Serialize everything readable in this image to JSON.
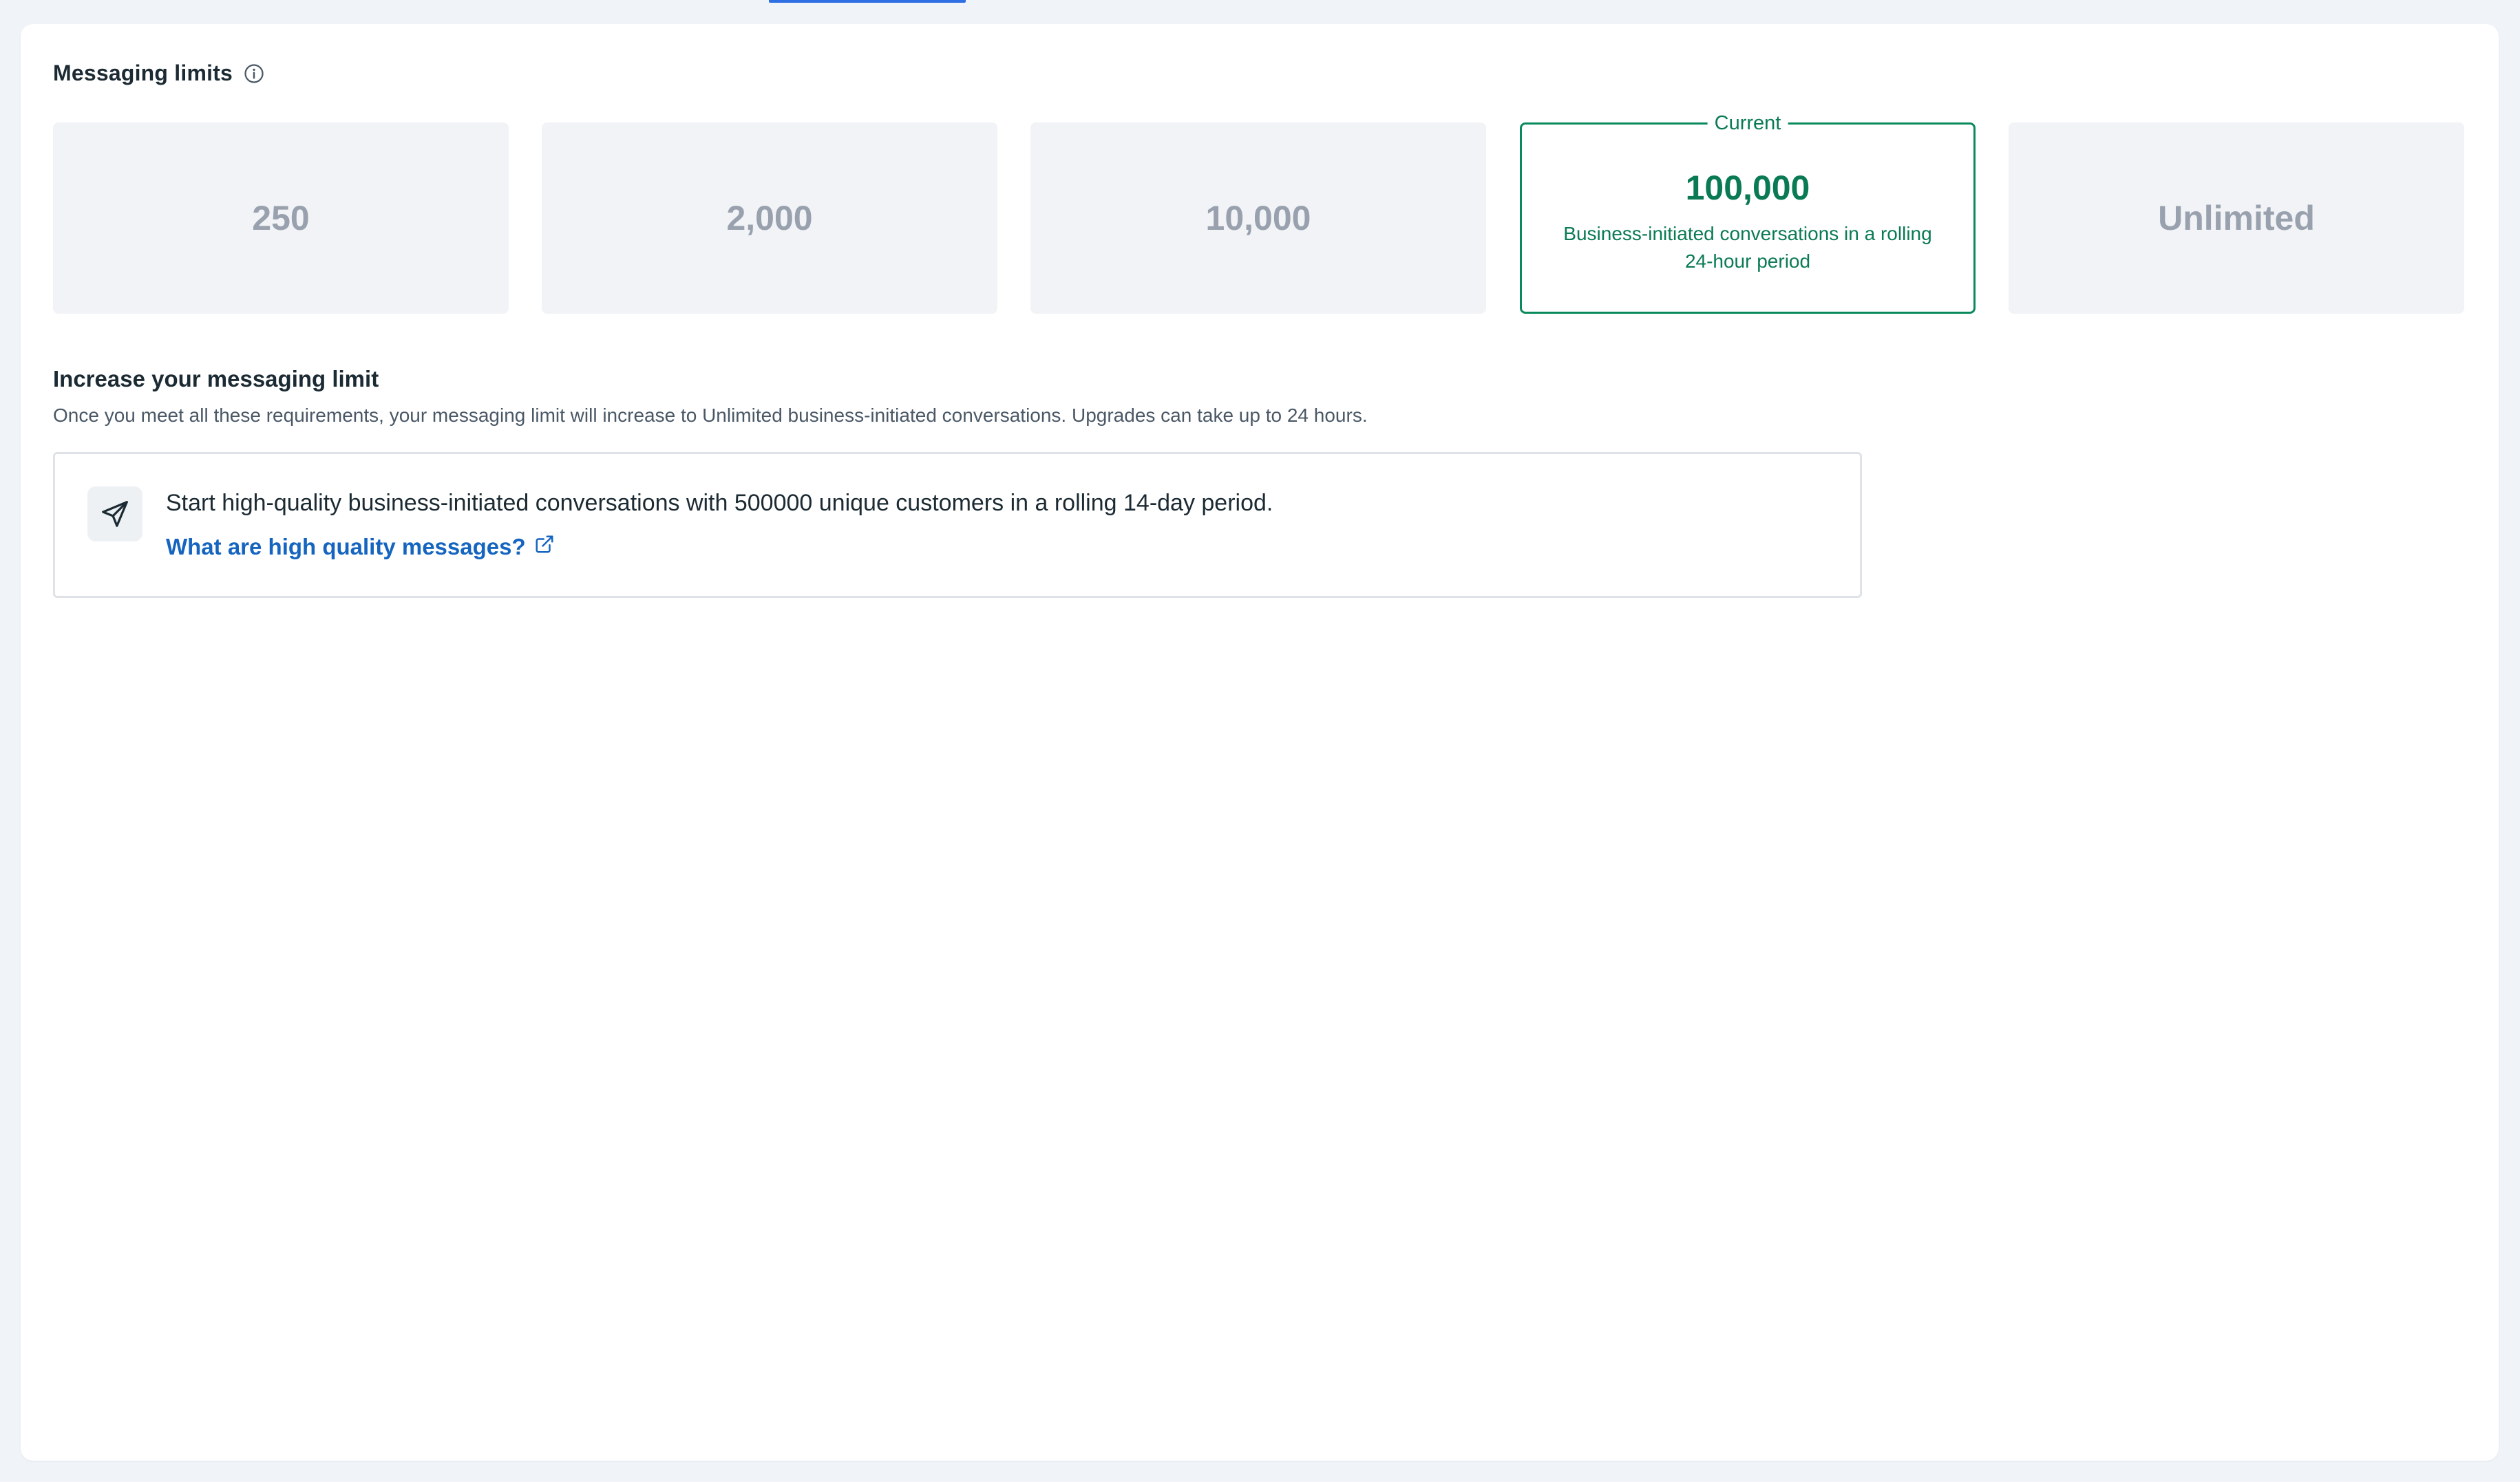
{
  "header": {
    "title": "Messaging limits",
    "info_icon": "info-circle-icon"
  },
  "tiers": [
    {
      "value": "250",
      "current": false
    },
    {
      "value": "2,000",
      "current": false
    },
    {
      "value": "10,000",
      "current": false
    },
    {
      "value": "100,000",
      "current": true,
      "badge": "Current",
      "description": "Business-initiated conversations in a rolling 24-hour period"
    },
    {
      "value": "Unlimited",
      "current": false
    }
  ],
  "increase_section": {
    "title": "Increase your messaging limit",
    "description": "Once you meet all these requirements, your messaging limit will increase to Unlimited business-initiated conversations. Upgrades can take up to 24 hours.",
    "requirement": {
      "icon": "send-paper-plane-icon",
      "text": "Start high-quality business-initiated conversations with 500000 unique customers in a rolling 14-day period.",
      "link_label": "What are high quality messages?",
      "link_icon": "external-link-icon"
    }
  },
  "colors": {
    "accent_green": "#0a7a55",
    "link_blue": "#1565c0",
    "tab_indicator": "#2f6fe4"
  }
}
